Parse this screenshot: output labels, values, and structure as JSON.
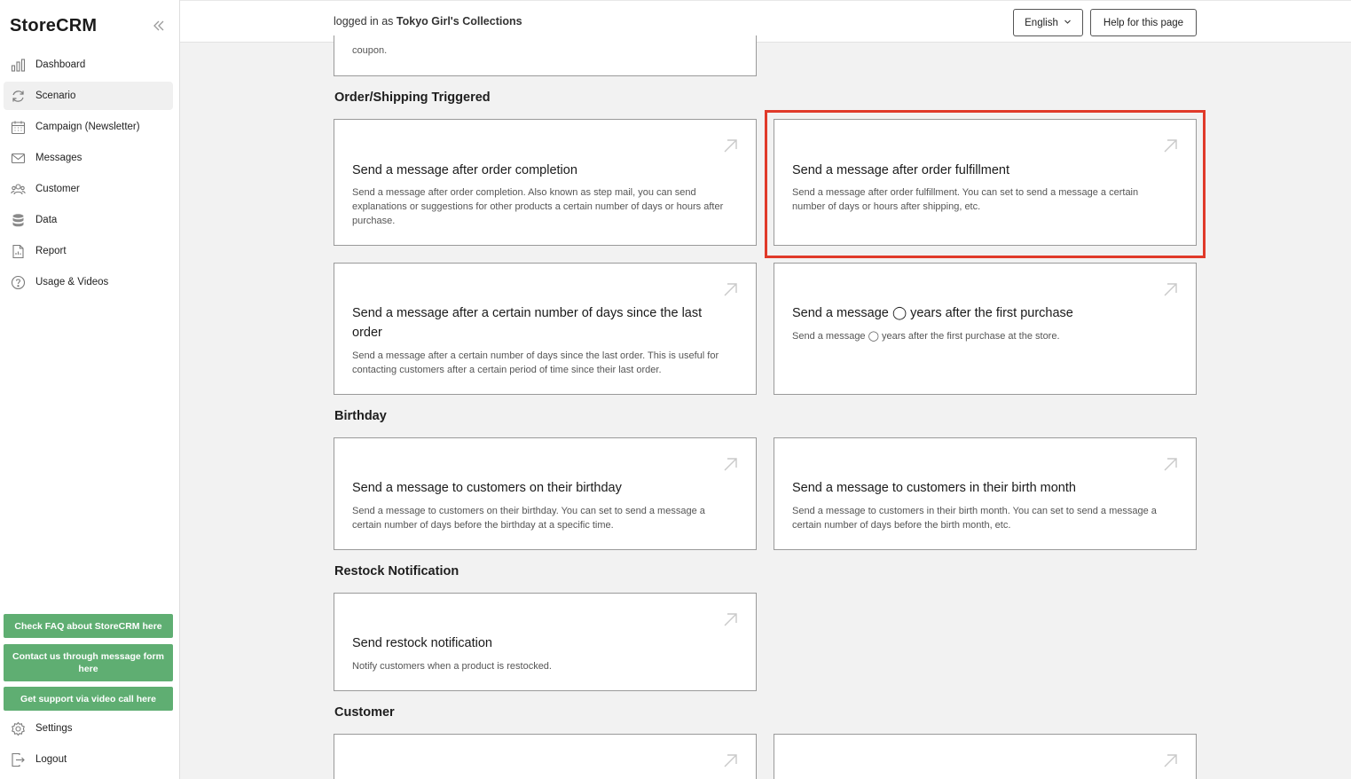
{
  "app": {
    "logo": "StoreCRM"
  },
  "sidebar": {
    "items": [
      {
        "label": "Dashboard",
        "icon": "bar-chart-icon"
      },
      {
        "label": "Scenario",
        "icon": "refresh-icon",
        "active": true
      },
      {
        "label": "Campaign (Newsletter)",
        "icon": "calendar-icon"
      },
      {
        "label": "Messages",
        "icon": "mail-icon"
      },
      {
        "label": "Customer",
        "icon": "users-icon"
      },
      {
        "label": "Data",
        "icon": "database-icon"
      },
      {
        "label": "Report",
        "icon": "document-icon"
      },
      {
        "label": "Usage & Videos",
        "icon": "help-circle-icon"
      }
    ],
    "help_buttons": [
      "Check FAQ about StoreCRM here",
      "Contact us through message form here",
      "Get support via video call here"
    ],
    "bottom": [
      {
        "label": "Settings",
        "icon": "gear-icon"
      },
      {
        "label": "Logout",
        "icon": "logout-icon"
      }
    ]
  },
  "header": {
    "login_prefix": "logged in as",
    "store_name": "Tokyo Girl's Collections",
    "language": "English",
    "help_label": "Help for this page"
  },
  "content": {
    "partial_card_text": "coupon.",
    "sections": {
      "order": "Order/Shipping Triggered",
      "birthday": "Birthday",
      "restock": "Restock Notification",
      "customer": "Customer"
    },
    "cards": {
      "order_completion": {
        "title": "Send a message after order completion",
        "desc": "Send a message after order completion. Also known as step mail, you can send explanations or suggestions for other products a certain number of days or hours after purchase."
      },
      "order_fulfillment": {
        "title": "Send a message after order fulfillment",
        "desc": "Send a message after order fulfillment. You can set to send a message a certain number of days or hours after shipping, etc."
      },
      "days_since_last": {
        "title": "Send a message after a certain number of days since the last order",
        "desc": "Send a message after a certain number of days since the last order. This is useful for contacting customers after a certain period of time since their last order."
      },
      "years_after_first": {
        "title": "Send a message ◯ years after the first purchase",
        "desc": "Send a message ◯ years after the first purchase at the store."
      },
      "birthday": {
        "title": "Send a message to customers on their birthday",
        "desc": "Send a message to customers on their birthday. You can set to send a message a certain number of days before the birthday at a specific time."
      },
      "birth_month": {
        "title": "Send a message to customers in their birth month",
        "desc": "Send a message to customers in their birth month. You can set to send a message a certain number of days before the birth month, etc."
      },
      "restock": {
        "title": "Send restock notification",
        "desc": "Notify customers when a product is restocked."
      }
    },
    "highlight_color": "#e03a2a",
    "help_button_color": "#5fae72"
  }
}
